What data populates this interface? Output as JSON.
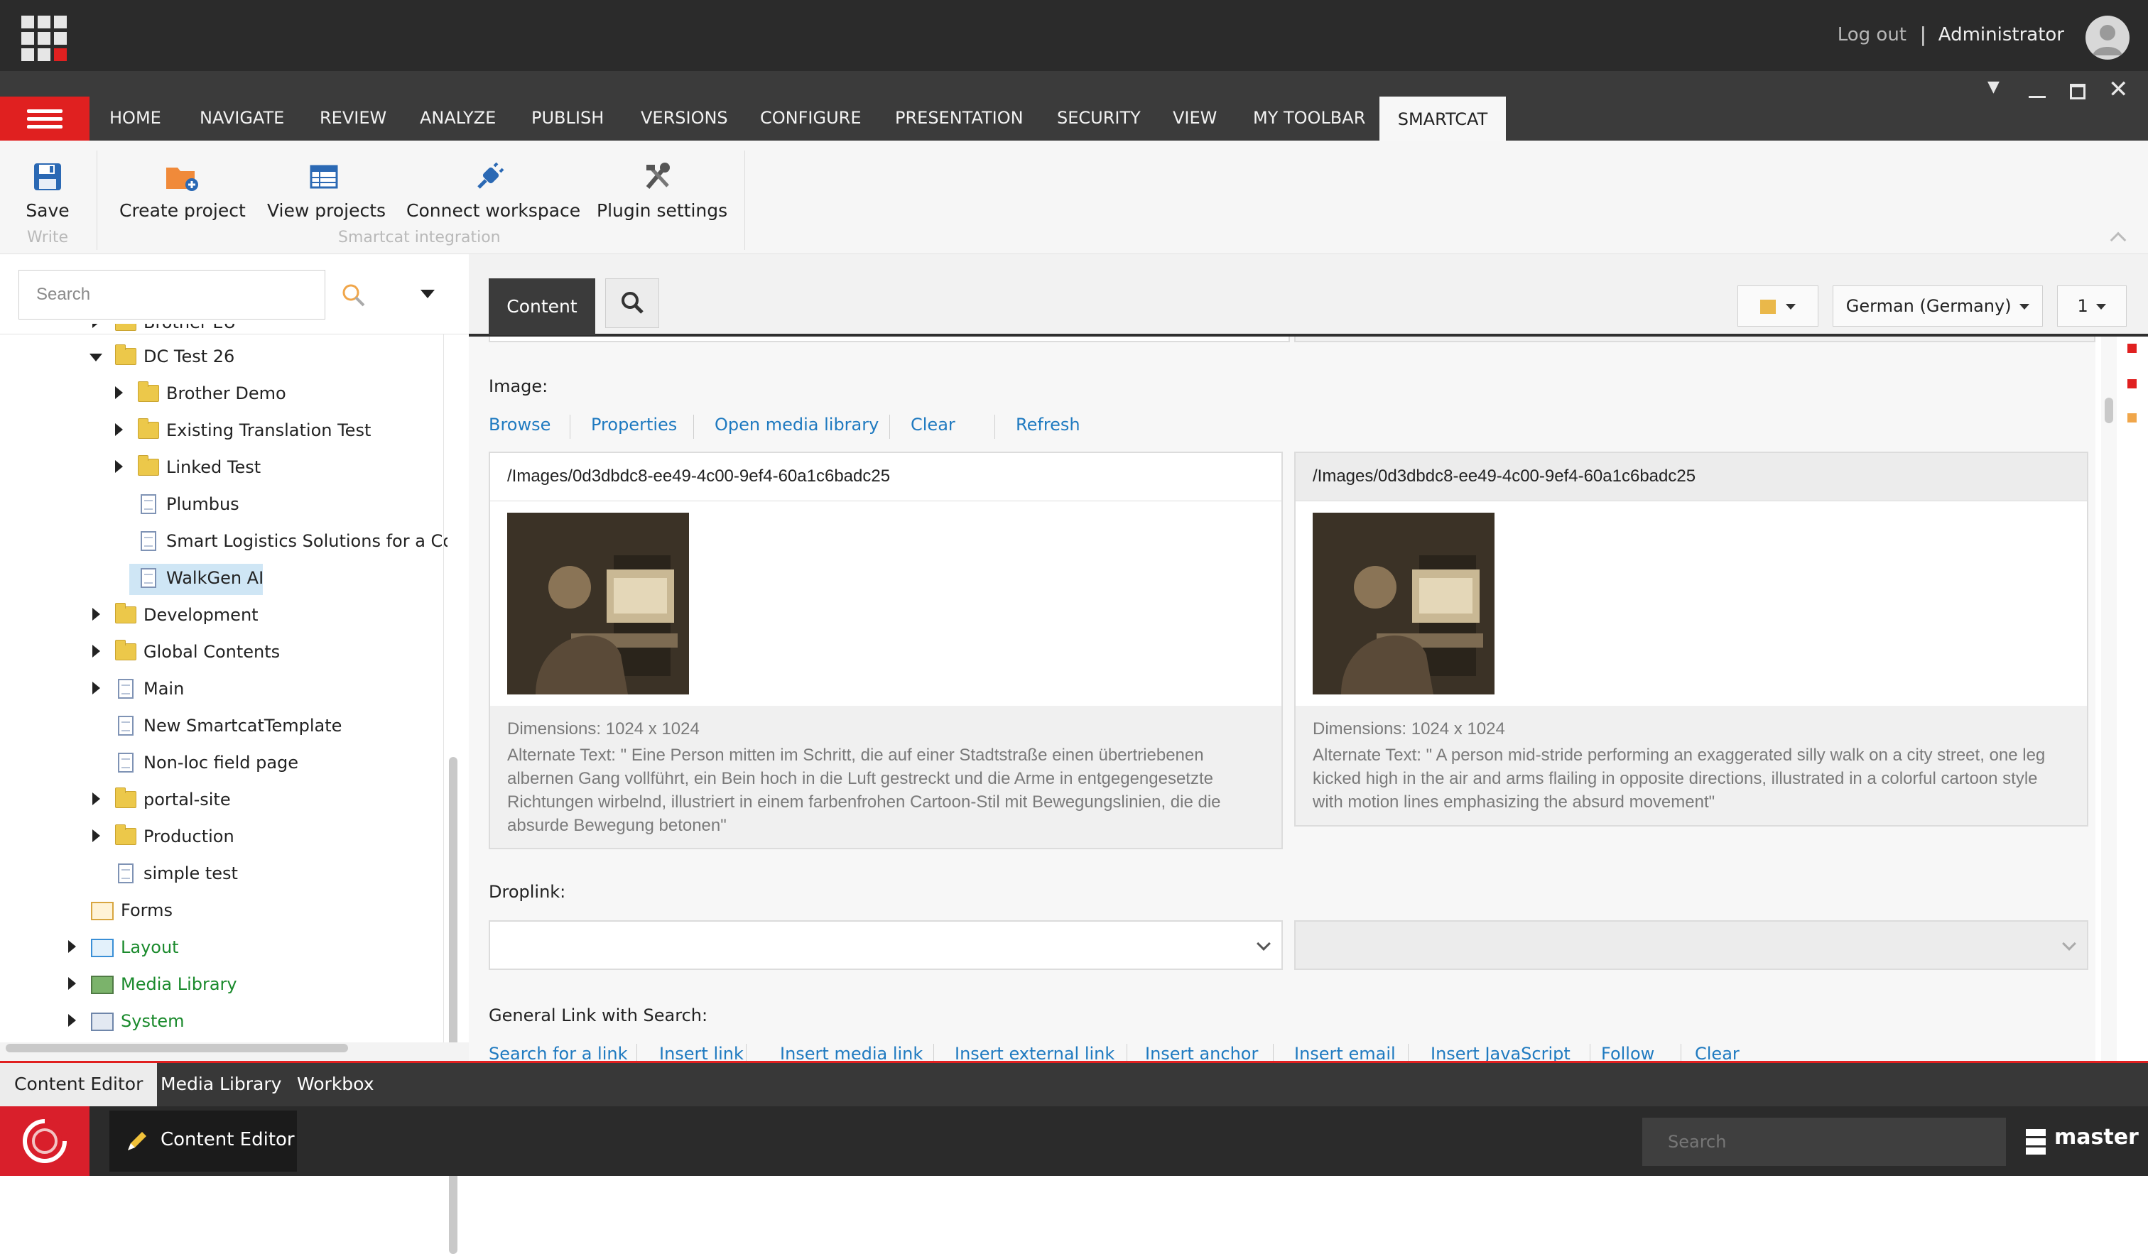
{
  "topbar": {
    "logout": "Log out",
    "separator": "|",
    "user": "Administrator"
  },
  "tabs": [
    "HOME",
    "NAVIGATE",
    "REVIEW",
    "ANALYZE",
    "PUBLISH",
    "VERSIONS",
    "CONFIGURE",
    "PRESENTATION",
    "SECURITY",
    "VIEW",
    "MY TOOLBAR"
  ],
  "active_tab": "SMARTCAT",
  "ribbon": {
    "save": "Save",
    "write_group": "Write",
    "create_project": "Create project",
    "view_projects": "View projects",
    "connect_workspace": "Connect workspace",
    "plugin_settings": "Plugin settings",
    "smartcat_group": "Smartcat integration"
  },
  "left": {
    "search_placeholder": "Search",
    "tree": {
      "brother_eu": "Brother EU",
      "dc_test": "DC Test 26",
      "brother_demo": "Brother Demo",
      "existing": "Existing Translation Test",
      "linked": "Linked Test",
      "plumbus": "Plumbus",
      "smart_logistics": "Smart Logistics Solutions for a Con",
      "walkgen": "WalkGen AI",
      "development": "Development",
      "global": "Global Contents",
      "main": "Main",
      "new_template": "New SmartcatTemplate",
      "nonloc": "Non-loc field page",
      "portal": "portal-site",
      "production": "Production",
      "simple": "simple test",
      "forms": "Forms",
      "layout": "Layout",
      "media": "Media Library",
      "system": "System"
    }
  },
  "editor": {
    "content_tab": "Content",
    "language": "German (Germany)",
    "version": "1",
    "image_label": "Image:",
    "image_links": [
      "Browse",
      "Properties",
      "Open media library",
      "Clear",
      "Refresh"
    ],
    "left_image": {
      "path": "/Images/0d3dbdc8-ee49-4c00-9ef4-60a1c6badc25",
      "dimensions": "Dimensions: 1024 x 1024",
      "alt": "Alternate Text: \" Eine Person mitten im Schritt, die auf einer Stadtstraße einen übertriebenen albernen Gang vollführt, ein Bein hoch in die Luft gestreckt und die Arme in entgegengesetzte Richtungen wirbelnd, illustriert in einem farbenfrohen Cartoon-Stil mit Bewegungslinien, die die absurde Bewegung betonen\""
    },
    "right_image": {
      "path": "/Images/0d3dbdc8-ee49-4c00-9ef4-60a1c6badc25",
      "dimensions": "Dimensions: 1024 x 1024",
      "alt": "Alternate Text: \" A person mid-stride performing an exaggerated silly walk on a city street, one leg kicked high in the air and arms flailing in opposite directions, illustrated in a colorful cartoon style with motion lines emphasizing the absurd movement\""
    },
    "droplink_label": "Droplink:",
    "general_link_label": "General Link with Search:",
    "general_links": [
      "Search for a link",
      "Insert link",
      "Insert media link",
      "Insert external link",
      "Insert anchor",
      "Insert email",
      "Insert JavaScript",
      "Follow",
      "Clear"
    ]
  },
  "bottom": {
    "tabs": [
      "Content Editor",
      "Media Library",
      "Workbox"
    ],
    "app": "Content Editor",
    "search_placeholder": "Search",
    "database": "master"
  },
  "colors": {
    "accent": "#e02020",
    "link": "#1f7ac0",
    "dark": "#2b2b2b"
  }
}
